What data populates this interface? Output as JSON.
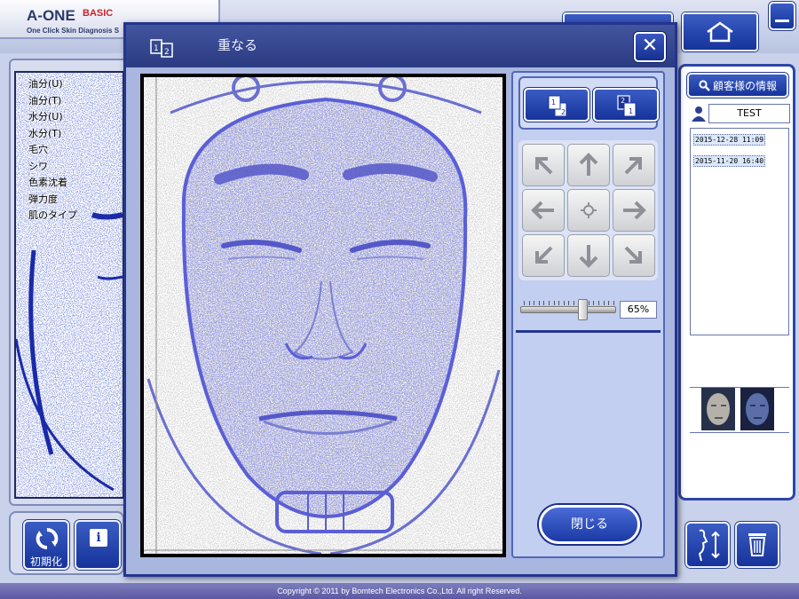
{
  "app": {
    "logo_title": "A-ONE",
    "logo_badge": "BASIC",
    "logo_subtitle": "One Click Skin Diagnosis S"
  },
  "menu": {
    "items": [
      "油分(U)",
      "油分(T)",
      "水分(U)",
      "水分(T)",
      "毛穴",
      "シワ",
      "色素沈着",
      "弾力度",
      "肌のタイプ"
    ]
  },
  "footer_left": {
    "reset_label": "初期化",
    "info_icon": "i"
  },
  "right_panel": {
    "customer_info_label": "顧客様の情報",
    "customer_name": "TEST",
    "dates": [
      "2015-12-28  11:09",
      "2015-11-20  16:40"
    ]
  },
  "dialog": {
    "title": "重なる",
    "close_x": "✕",
    "order_buttons": [
      {
        "front": "1",
        "back": "2"
      },
      {
        "front": "2",
        "back": "1"
      }
    ],
    "opacity_percent": 65,
    "opacity_text": "65%",
    "close_label": "閉じる"
  },
  "copyright": "Copyright © 2011 by Bomtech Electronics Co.,Ltd. All right Reserved.",
  "colors": {
    "accent": "#1e3aa5",
    "overlay_blue": "#5b5fd6",
    "panel": "#c3cff0"
  }
}
